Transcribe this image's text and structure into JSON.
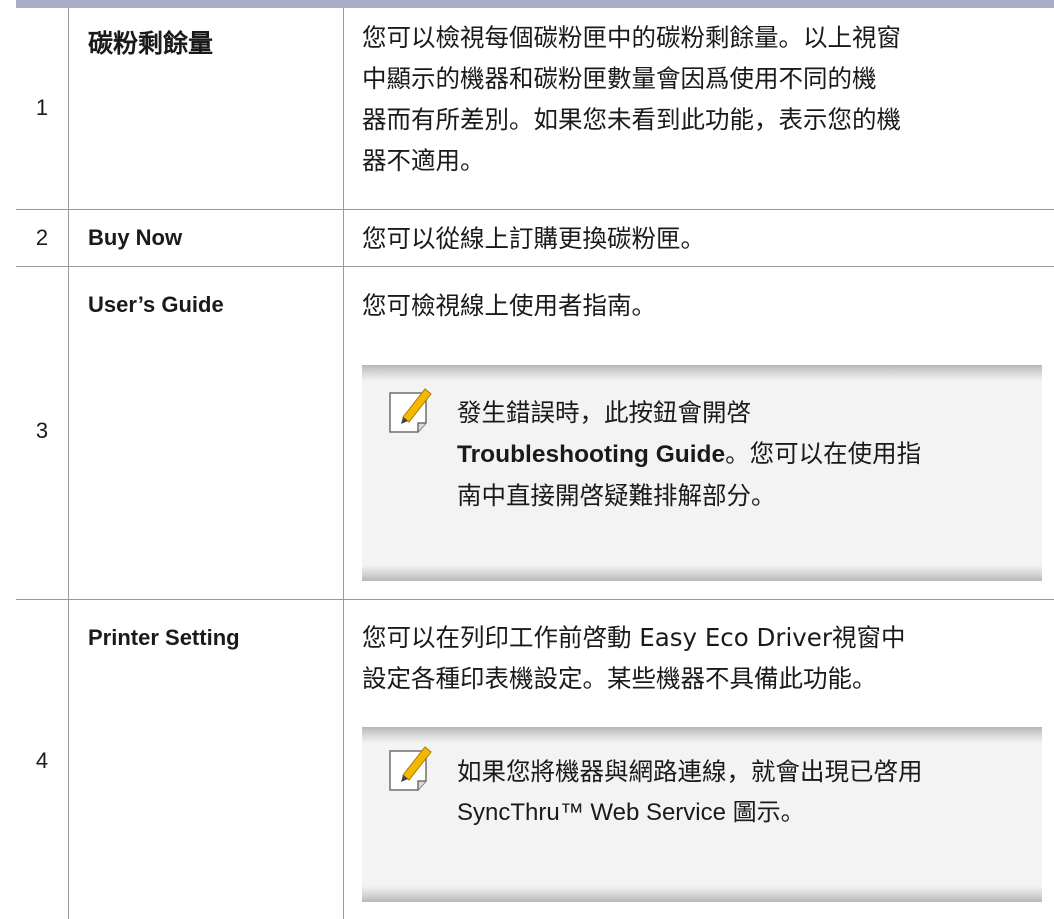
{
  "rows": [
    {
      "number": "1",
      "feature": "碳粉剩餘量",
      "description": "您可以檢視每個碳粉匣中的碳粉剩餘量。以上視窗中顯示的機器和碳粉匣數量會因爲使用不同的機器而有所差別。如果您未看到此功能，表示您的機器不適用。",
      "description_lines": [
        "您可以檢視每個碳粉匣中的碳粉剩餘量。以上視窗",
        "中顯示的機器和碳粉匣數量會因爲使用不同的機",
        "器而有所差別。如果您未看到此功能，表示您的機",
        "器不適用。"
      ]
    },
    {
      "number": "2",
      "feature": "Buy Now",
      "description": "您可以從線上訂購更換碳粉匣。"
    },
    {
      "number": "3",
      "feature": "User’s Guide",
      "description": "您可檢視線上使用者指南。",
      "note": {
        "icon": "pencil-note-icon",
        "line1": "發生錯誤時，此按鈕會開啓",
        "bold": "Troubleshooting Guide",
        "after_bold": "。您可以在使用指",
        "line3": "南中直接開啓疑難排解部分。"
      }
    },
    {
      "number": "4",
      "feature": "Printer Setting",
      "description_line1": "您可以在列印工作前啓動 Easy Eco Driver視窗中",
      "description_line2": "設定各種印表機設定。某些機器不具備此功能。",
      "note": {
        "icon": "pencil-note-icon",
        "line1": "如果您將機器與網路連線，就會出現已啓用",
        "line2": "SyncThru™ Web Service 圖示。"
      }
    }
  ],
  "colors": {
    "header_rule": "#a9aec8",
    "grid": "#9a9a9a",
    "note_bg": "#f3f3f3"
  }
}
